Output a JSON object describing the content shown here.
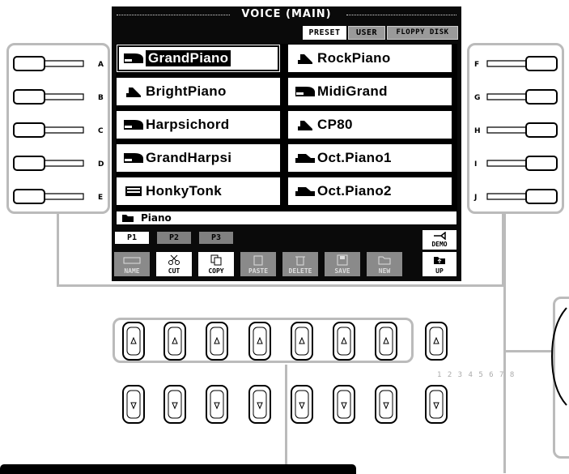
{
  "screen": {
    "title": "VOICE (MAIN)",
    "bank_tabs": [
      "PRESET",
      "USER",
      "FLOPPY DISK"
    ],
    "voices_left": [
      {
        "label": "GrandPiano",
        "icon": "grand-piano-icon",
        "selected": true
      },
      {
        "label": "BrightPiano",
        "icon": "upright-piano-icon"
      },
      {
        "label": "Harpsichord",
        "icon": "grand-piano-icon"
      },
      {
        "label": "GrandHarpsi",
        "icon": "grand-piano-icon"
      },
      {
        "label": "HonkyTonk",
        "icon": "honky-tonk-icon"
      }
    ],
    "voices_right": [
      {
        "label": "RockPiano",
        "icon": "upright-piano-icon"
      },
      {
        "label": "MidiGrand",
        "icon": "grand-piano-icon"
      },
      {
        "label": "CP80",
        "icon": "upright-piano-icon"
      },
      {
        "label": "Oct.Piano1",
        "icon": "keyboard-icon"
      },
      {
        "label": "Oct.Piano2",
        "icon": "keyboard-icon"
      }
    ],
    "folder": "Piano",
    "pages": [
      "P1",
      "P2",
      "P3"
    ],
    "demo": "DEMO",
    "functions": [
      "NAME",
      "CUT",
      "COPY",
      "PASTE",
      "DELETE",
      "SAVE",
      "NEW",
      "UP"
    ]
  },
  "left_buttons": [
    "A",
    "B",
    "C",
    "D",
    "E"
  ],
  "right_buttons": [
    "F",
    "G",
    "H",
    "I",
    "J"
  ],
  "number_label": "1 2 3 4 5 6 7 8",
  "colors": {
    "screen": "#0a0a0a",
    "frame": "#bbbbbb"
  }
}
